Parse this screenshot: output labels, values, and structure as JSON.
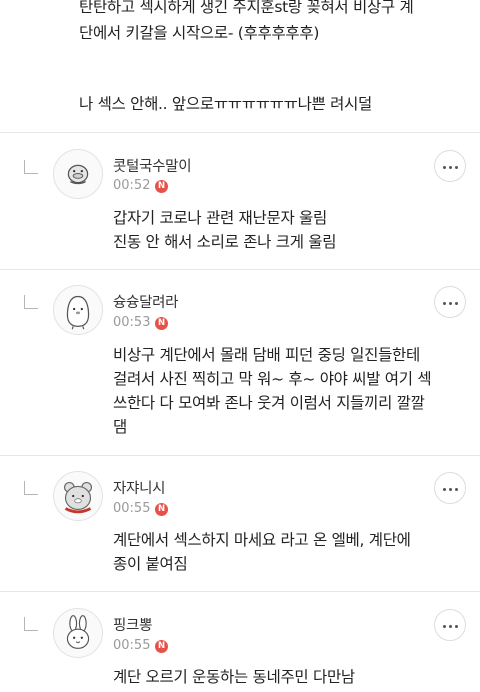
{
  "post": {
    "lines": [
      "탄탄하고 섹시하게 생긴 주지훈st랑 꽂혀서 비상구 계",
      "단에서 키갈을 시작으로- (후후후후후)",
      "나 섹스 안해.. 앞으로ㅠㅠㅠㅠㅠㅠ나쁜 려시덜"
    ]
  },
  "comments": [
    {
      "nickname": "콧털국수말이",
      "time": "00:52",
      "badge": "N",
      "avatar_icon": "duck-avatar-icon",
      "body": [
        "갑자기 코로나 관련 재난문자 울림",
        "진동 안 해서 소리로 존나 크게 울림"
      ]
    },
    {
      "nickname": "슝슝달려라",
      "time": "00:53",
      "badge": "N",
      "avatar_icon": "penguin-avatar-icon",
      "body": [
        "비상구 계단에서 몰래 담배 피던 중딩 일진들한테",
        "걸려서 사진 찍히고 막 워~ 후~ 야야 씨발 여기 섹",
        "쓰한다 다 모여봐 존나 웃겨 이럼서 지들끼리 깔깔",
        "댐"
      ]
    },
    {
      "nickname": "자쟈니시",
      "time": "00:55",
      "badge": "N",
      "avatar_icon": "bear-avatar-icon",
      "body": [
        "계단에서 섹스하지 마세요 라고 온 엘베, 계단에",
        "종이 붙여짐"
      ]
    },
    {
      "nickname": "핑크뽕",
      "time": "00:55",
      "badge": "N",
      "avatar_icon": "rabbit-avatar-icon",
      "body": [
        "계단 오르기 운동하는 동네주민 다만남"
      ]
    }
  ],
  "colors": {
    "badge": "#e8514a",
    "divider": "#e6e6e6",
    "time": "#9a9a9a"
  }
}
